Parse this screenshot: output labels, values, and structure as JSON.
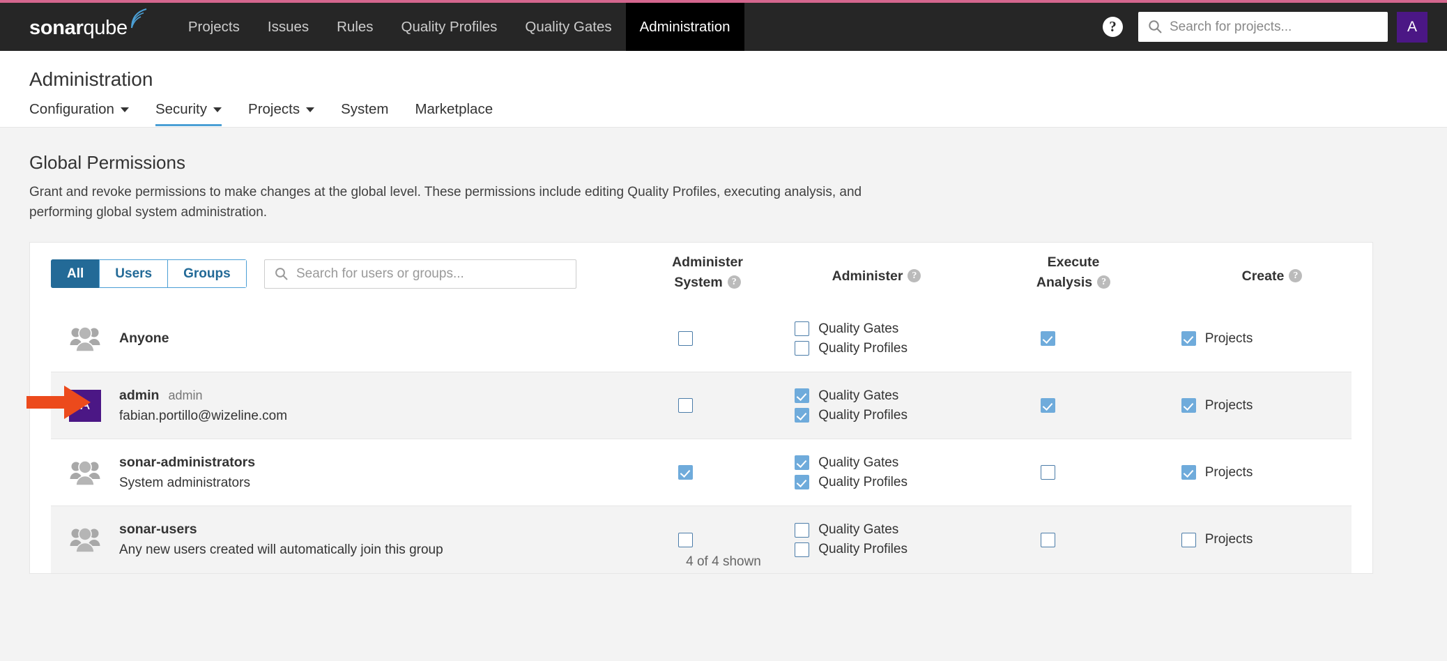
{
  "navbar": {
    "brand_bold": "sonar",
    "brand_light": "qube",
    "links": [
      {
        "label": "Projects",
        "active": false
      },
      {
        "label": "Issues",
        "active": false
      },
      {
        "label": "Rules",
        "active": false
      },
      {
        "label": "Quality Profiles",
        "active": false
      },
      {
        "label": "Quality Gates",
        "active": false
      },
      {
        "label": "Administration",
        "active": true
      }
    ],
    "help_icon": "help-icon",
    "search_icon": "search-icon",
    "search_placeholder": "Search for projects...",
    "avatar_initial": "A",
    "avatar_color": "#4b1785",
    "top_stripe_color": "#d4668e"
  },
  "page": {
    "title": "Administration",
    "tabs": [
      {
        "label": "Configuration",
        "has_caret": true,
        "active": false
      },
      {
        "label": "Security",
        "has_caret": true,
        "active": true
      },
      {
        "label": "Projects",
        "has_caret": true,
        "active": false
      },
      {
        "label": "System",
        "has_caret": false,
        "active": false
      },
      {
        "label": "Marketplace",
        "has_caret": false,
        "active": false
      }
    ],
    "active_tab_underline_color": "#4b9fd5"
  },
  "section": {
    "heading": "Global Permissions",
    "description": "Grant and revoke permissions to make changes at the global level. These permissions include editing Quality Profiles, executing analysis, and performing global system administration."
  },
  "toolbar": {
    "filters": [
      {
        "label": "All",
        "active": true
      },
      {
        "label": "Users",
        "active": false
      },
      {
        "label": "Groups",
        "active": false
      }
    ],
    "search_icon": "search-icon",
    "search_placeholder": "Search for users or groups..."
  },
  "columns": [
    {
      "key": "administer_system",
      "line1": "Administer",
      "line2": "System",
      "help": true
    },
    {
      "key": "administer",
      "line1": "Administer",
      "line2": "",
      "help": true
    },
    {
      "key": "execute_analysis",
      "line1": "Execute",
      "line2": "Analysis",
      "help": true
    },
    {
      "key": "create",
      "line1": "Create",
      "line2": "",
      "help": true
    }
  ],
  "rows": [
    {
      "type": "group",
      "icon": "group-icon",
      "name": "Anyone",
      "subtitle": "",
      "login": "",
      "highlighted": false,
      "administer_system": false,
      "administer": [
        {
          "label": "Quality Gates",
          "checked": false
        },
        {
          "label": "Quality Profiles",
          "checked": false
        }
      ],
      "execute_analysis": true,
      "create": [
        {
          "label": "Projects",
          "checked": true
        }
      ]
    },
    {
      "type": "user",
      "icon": "user-avatar",
      "avatar_initial": "A",
      "name": "admin",
      "login": "admin",
      "subtitle": "fabian.portillo@wizeline.com",
      "highlighted": true,
      "administer_system": false,
      "administer": [
        {
          "label": "Quality Gates",
          "checked": true
        },
        {
          "label": "Quality Profiles",
          "checked": true
        }
      ],
      "execute_analysis": true,
      "create": [
        {
          "label": "Projects",
          "checked": true
        }
      ]
    },
    {
      "type": "group",
      "icon": "group-icon",
      "name": "sonar-administrators",
      "login": "",
      "subtitle": "System administrators",
      "highlighted": false,
      "administer_system": true,
      "administer": [
        {
          "label": "Quality Gates",
          "checked": true
        },
        {
          "label": "Quality Profiles",
          "checked": true
        }
      ],
      "execute_analysis": false,
      "create": [
        {
          "label": "Projects",
          "checked": true
        }
      ]
    },
    {
      "type": "group",
      "icon": "group-icon",
      "name": "sonar-users",
      "login": "",
      "subtitle": "Any new users created will automatically join this group",
      "highlighted": true,
      "administer_system": false,
      "administer": [
        {
          "label": "Quality Gates",
          "checked": false
        },
        {
          "label": "Quality Profiles",
          "checked": false
        }
      ],
      "execute_analysis": false,
      "create": [
        {
          "label": "Projects",
          "checked": false
        }
      ]
    }
  ],
  "footer": {
    "count_text": "4 of 4 shown"
  },
  "annotation": {
    "arrow": "right-arrow-annotation",
    "color": "#ec4a1c"
  }
}
